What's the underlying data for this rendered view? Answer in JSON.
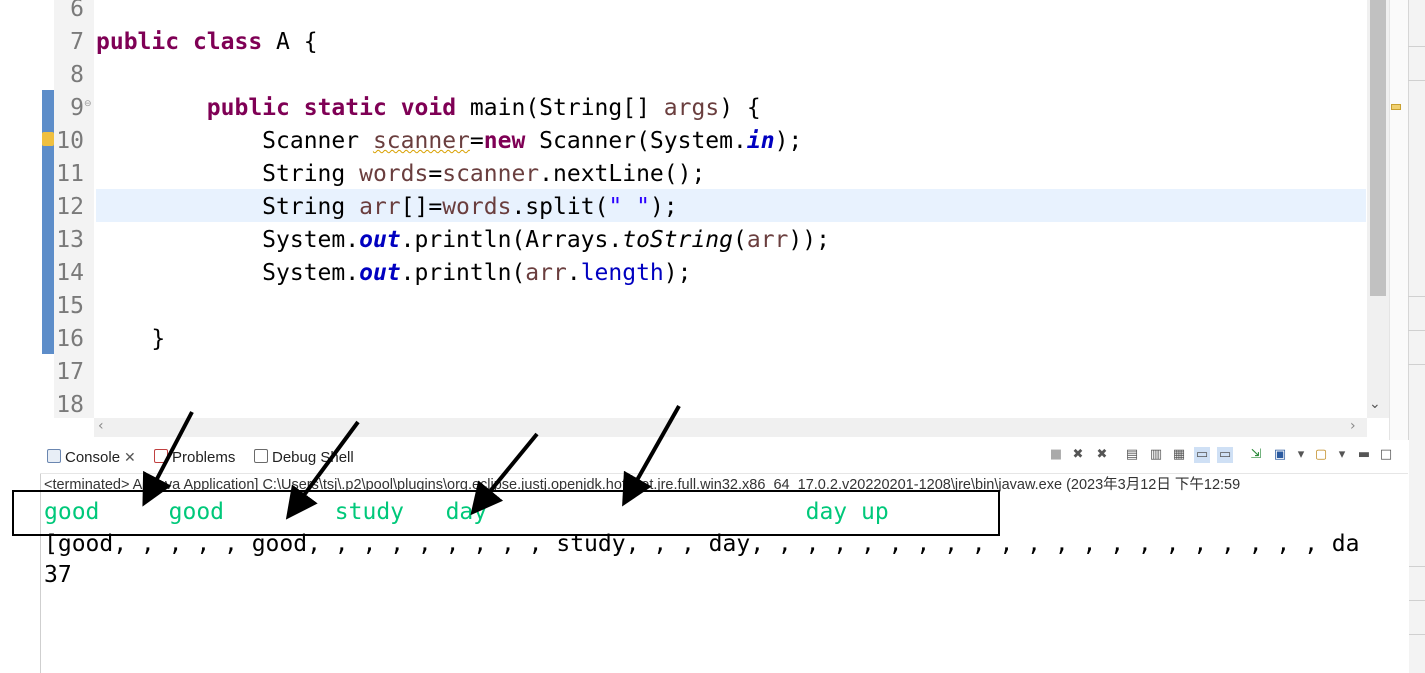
{
  "editor": {
    "line_numbers": [
      "6",
      "7",
      "8",
      "9",
      "10",
      "11",
      "12",
      "13",
      "14",
      "15",
      "16",
      "17",
      "18"
    ],
    "highlighted_line": "12"
  },
  "console": {
    "tabs": [
      {
        "label": "Console"
      },
      {
        "label": "Problems"
      },
      {
        "label": "Debug Shell"
      }
    ],
    "terminated_text": "<terminated> A [Java Application] C:\\Users\\tsj\\.p2\\pool\\plugins\\org.eclipse.justj.openjdk.hotspot.jre.full.win32.x86_64_17.0.2.v20220201-1208\\jre\\bin\\javaw.exe  (2023年3月12日 下午12:59",
    "input_line": "good     good        study   day                       day up",
    "array_output": "[good, , , , , good, , , , , , , , , study, , , day, , , , , , , , , , , , , , , , , , , , , da",
    "length_output": "37"
  },
  "colors": {
    "keyword": "#7f0055",
    "local_var": "#6a3e3e",
    "field": "#0000c0",
    "string": "#2a00ff",
    "console_input": "#00c87a",
    "current_line": "#e8f2fe",
    "ruler_blue": "#5d8dc9"
  }
}
